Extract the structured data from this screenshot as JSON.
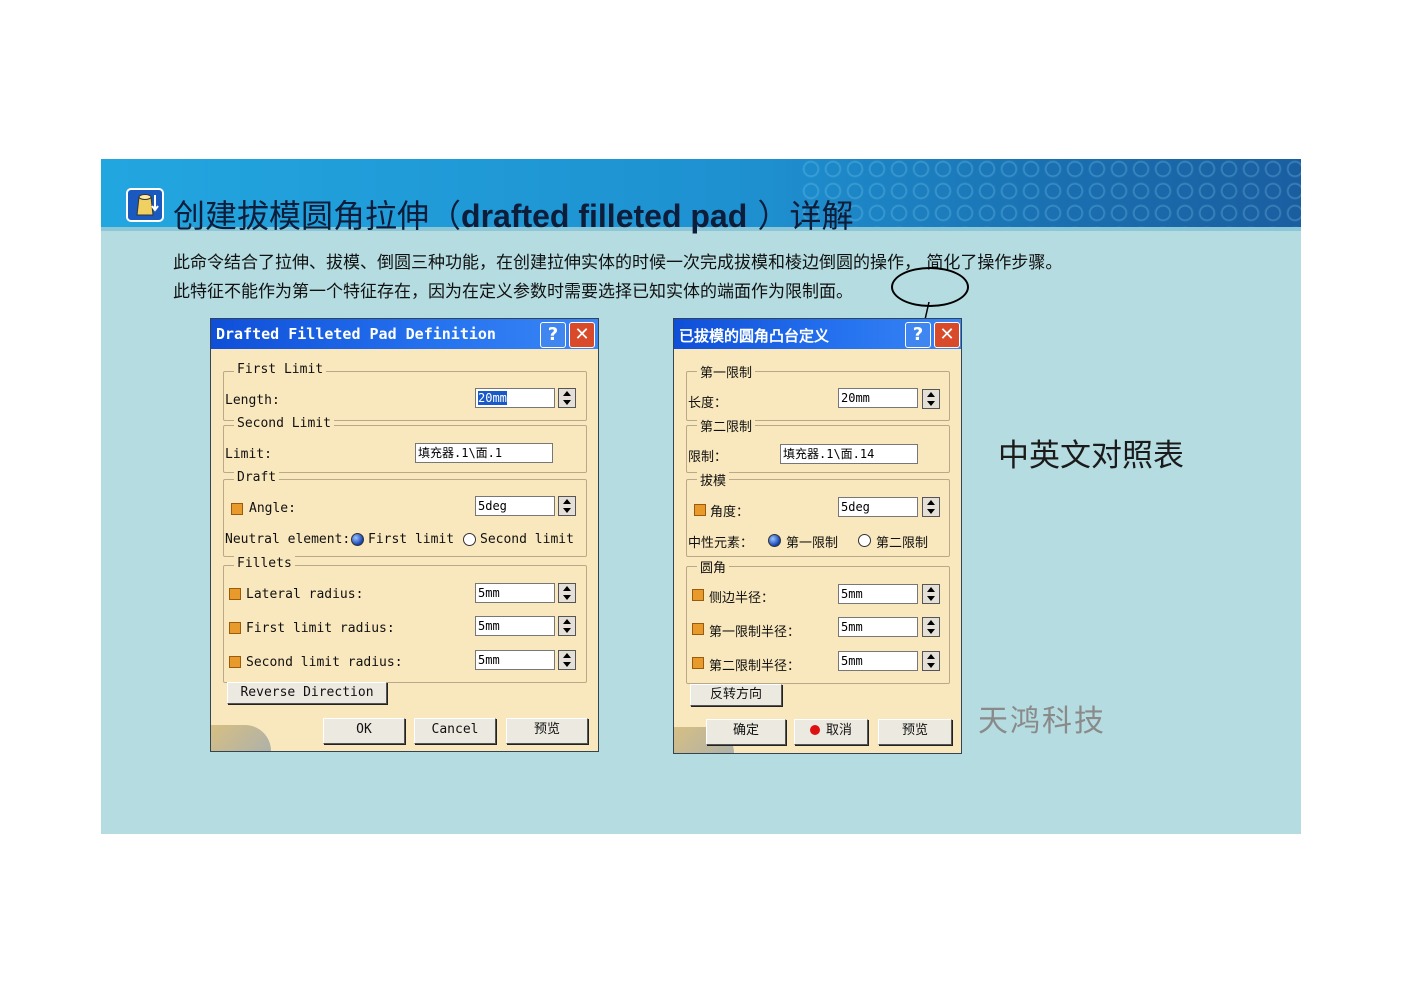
{
  "title": {
    "prefix": "创建拔模圆角拉伸（",
    "bold": "drafted filleted pad",
    "suffix": " ）详解"
  },
  "desc_line1": "此命令结合了拉伸、拔模、倒圆三种功能，在创建拉伸实体的时候一次完成拔模和棱边倒圆的操作，  简化了操作步骤。",
  "desc_line2": "此特征不能作为第一个特征存在，因为在定义参数时需要选择已知实体的端面作为限制面。",
  "en_dialog": {
    "title": "Drafted Filleted Pad Definition",
    "first_limit": "First Limit",
    "length_label": "Length:",
    "length_value": "20mm",
    "second_limit": "Second Limit",
    "limit_label": "Limit:",
    "limit_value": "填充器.1\\面.1",
    "draft": "Draft",
    "angle_label": "Angle:",
    "angle_value": "5deg",
    "neutral_label": "Neutral element:",
    "first_limit_option": "First limit",
    "second_limit_option": "Second limit",
    "fillets": "Fillets",
    "lateral_label": "Lateral radius:",
    "lateral_value": "5mm",
    "first_radius_label": "First limit radius:",
    "first_radius_value": "5mm",
    "second_radius_label": "Second limit radius:",
    "second_radius_value": "5mm",
    "reverse": "Reverse Direction",
    "ok": "OK",
    "cancel": "Cancel",
    "preview": "预览"
  },
  "cn_dialog": {
    "title": "已拔模的圆角凸台定义",
    "first_limit": "第一限制",
    "length_label": "长度：",
    "length_value": "20mm",
    "second_limit": "第二限制",
    "limit_label": "限制：",
    "limit_value": "填充器.1\\面.14",
    "draft": "拔模",
    "angle_label": "角度：",
    "angle_value": "5deg",
    "neutral_label": "中性元素：",
    "first_limit_option": "第一限制",
    "second_limit_option": "第二限制",
    "fillets": "圆角",
    "lateral_label": "侧边半径：",
    "lateral_value": "5mm",
    "first_radius_label": "第一限制半径：",
    "first_radius_value": "5mm",
    "second_radius_label": "第二限制半径：",
    "second_radius_value": "5mm",
    "reverse": "反转方向",
    "ok": "确定",
    "cancel": "取消",
    "preview": "预览"
  },
  "compare_label": "中英文对照表",
  "company": "天鸿科技",
  "colors": {
    "header": "#1e90d0",
    "slide_bg": "#b5dce0",
    "dialog_bg": "#f9e8bd",
    "titlebar": "#1a5ad8"
  }
}
